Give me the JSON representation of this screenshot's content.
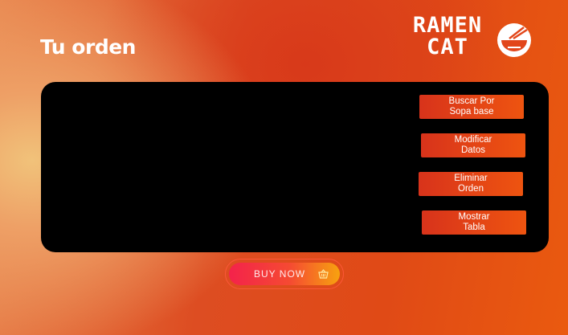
{
  "header": {
    "title": "Tu orden",
    "logo_text_line1": "RAMEN",
    "logo_text_line2": "CAT",
    "logo_icon": "ramen-bowl-icon"
  },
  "actions": [
    {
      "label": "Buscar Por\nSopa base"
    },
    {
      "label": "Modificar\nDatos"
    },
    {
      "label": "Eliminar\nOrden"
    },
    {
      "label": "Mostrar\nTabla"
    }
  ],
  "cta": {
    "label": "BUY NOW",
    "icon": "basket-icon"
  },
  "colors": {
    "panel": "#000000",
    "button_gradient_start": "#d8331b",
    "button_gradient_end": "#ee5410",
    "cta_gradient_start": "#f4224b",
    "cta_gradient_end": "#f7a20f"
  }
}
